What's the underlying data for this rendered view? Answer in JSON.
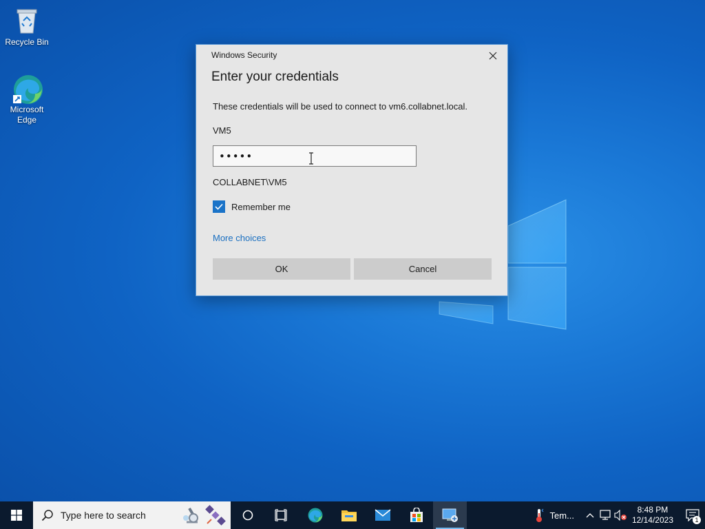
{
  "desktop": {
    "icons": [
      {
        "label": "Recycle Bin"
      },
      {
        "label": "Microsoft Edge"
      }
    ]
  },
  "dialog": {
    "title": "Windows Security",
    "heading": "Enter your credentials",
    "description": "These credentials will be used to connect to vm6.collabnet.local.",
    "username": "VM5",
    "password_value": "•••••",
    "domain_user": "COLLABNET\\VM5",
    "remember_label": "Remember me",
    "remember_checked": true,
    "more_choices": "More choices",
    "ok_label": "OK",
    "cancel_label": "Cancel"
  },
  "taskbar": {
    "search_placeholder": "Type here to search",
    "weather_label": "Tem...",
    "time": "8:48 PM",
    "date": "12/14/2023",
    "notification_count": "1"
  },
  "colors": {
    "accent": "#1a73c8",
    "link": "#1a6fc0",
    "taskbar": "#0b1a2e"
  }
}
